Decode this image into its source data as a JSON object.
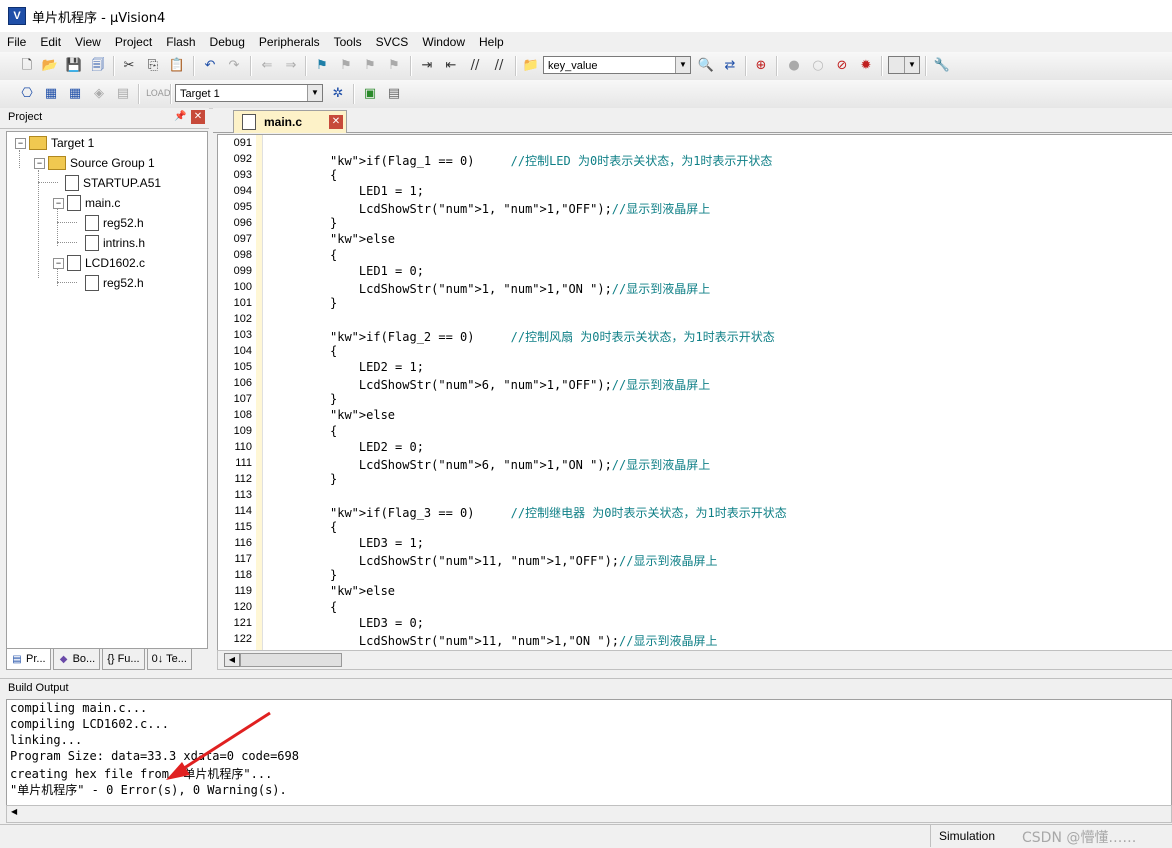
{
  "window": {
    "title": "单片机程序  - µVision4",
    "icon": "uvision-icon"
  },
  "menu": [
    "File",
    "Edit",
    "View",
    "Project",
    "Flash",
    "Debug",
    "Peripherals",
    "Tools",
    "SVCS",
    "Window",
    "Help"
  ],
  "toolbar": {
    "find_combo": "key_value",
    "target_combo": "Target 1"
  },
  "project": {
    "header": "Project",
    "tree": [
      {
        "label": "Target 1",
        "level": 0
      },
      {
        "label": "Source Group 1",
        "level": 1
      },
      {
        "label": "STARTUP.A51",
        "level": 2
      },
      {
        "label": "main.c",
        "level": 2
      },
      {
        "label": "reg52.h",
        "level": 3
      },
      {
        "label": "intrins.h",
        "level": 3
      },
      {
        "label": "LCD1602.c",
        "level": 2
      },
      {
        "label": "reg52.h",
        "level": 3
      }
    ],
    "tabs": [
      "Pr...",
      "Bo...",
      "{} Fu...",
      "0↓ Te..."
    ]
  },
  "editor": {
    "tab": "main.c",
    "lines": [
      {
        "n": "091",
        "code": ""
      },
      {
        "n": "092",
        "code": "if(Flag_1 == 0)     //控制LED 为0时表示关状态，为1时表示开状态"
      },
      {
        "n": "093",
        "code": "{"
      },
      {
        "n": "094",
        "code": "    LED1 = 1;"
      },
      {
        "n": "095",
        "code": "    LcdShowStr(1, 1,\"OFF\");//显示到液晶屏上"
      },
      {
        "n": "096",
        "code": "}"
      },
      {
        "n": "097",
        "code": "else"
      },
      {
        "n": "098",
        "code": "{"
      },
      {
        "n": "099",
        "code": "    LED1 = 0;"
      },
      {
        "n": "100",
        "code": "    LcdShowStr(1, 1,\"ON \");//显示到液晶屏上"
      },
      {
        "n": "101",
        "code": "}"
      },
      {
        "n": "102",
        "code": ""
      },
      {
        "n": "103",
        "code": "if(Flag_2 == 0)     //控制风扇 为0时表示关状态，为1时表示开状态"
      },
      {
        "n": "104",
        "code": "{"
      },
      {
        "n": "105",
        "code": "    LED2 = 1;"
      },
      {
        "n": "106",
        "code": "    LcdShowStr(6, 1,\"OFF\");//显示到液晶屏上"
      },
      {
        "n": "107",
        "code": "}"
      },
      {
        "n": "108",
        "code": "else"
      },
      {
        "n": "109",
        "code": "{"
      },
      {
        "n": "110",
        "code": "    LED2 = 0;"
      },
      {
        "n": "111",
        "code": "    LcdShowStr(6, 1,\"ON \");//显示到液晶屏上"
      },
      {
        "n": "112",
        "code": "}"
      },
      {
        "n": "113",
        "code": ""
      },
      {
        "n": "114",
        "code": "if(Flag_3 == 0)     //控制继电器 为0时表示关状态，为1时表示开状态"
      },
      {
        "n": "115",
        "code": "{"
      },
      {
        "n": "116",
        "code": "    LED3 = 1;"
      },
      {
        "n": "117",
        "code": "    LcdShowStr(11, 1,\"OFF\");//显示到液晶屏上"
      },
      {
        "n": "118",
        "code": "}"
      },
      {
        "n": "119",
        "code": "else"
      },
      {
        "n": "120",
        "code": "{"
      },
      {
        "n": "121",
        "code": "    LED3 = 0;"
      },
      {
        "n": "122",
        "code": "    LcdShowStr(11, 1,\"ON \");//显示到液晶屏上"
      }
    ]
  },
  "build": {
    "header": "Build Output",
    "lines": [
      "compiling main.c...",
      "compiling LCD1602.c...",
      "linking...",
      "Program Size: data=33.3 xdata=0 code=698",
      "creating hex file from \"单片机程序\"...",
      "\"单片机程序\" - 0 Error(s), 0 Warning(s)."
    ]
  },
  "status": {
    "mode": "Simulation",
    "watermark": "CSDN @懵懂……"
  },
  "colors": {
    "comment": "#0e7f86",
    "number": "#800080",
    "tab_active": "#fdf2c8",
    "annotation_arrow": "#e02020"
  }
}
